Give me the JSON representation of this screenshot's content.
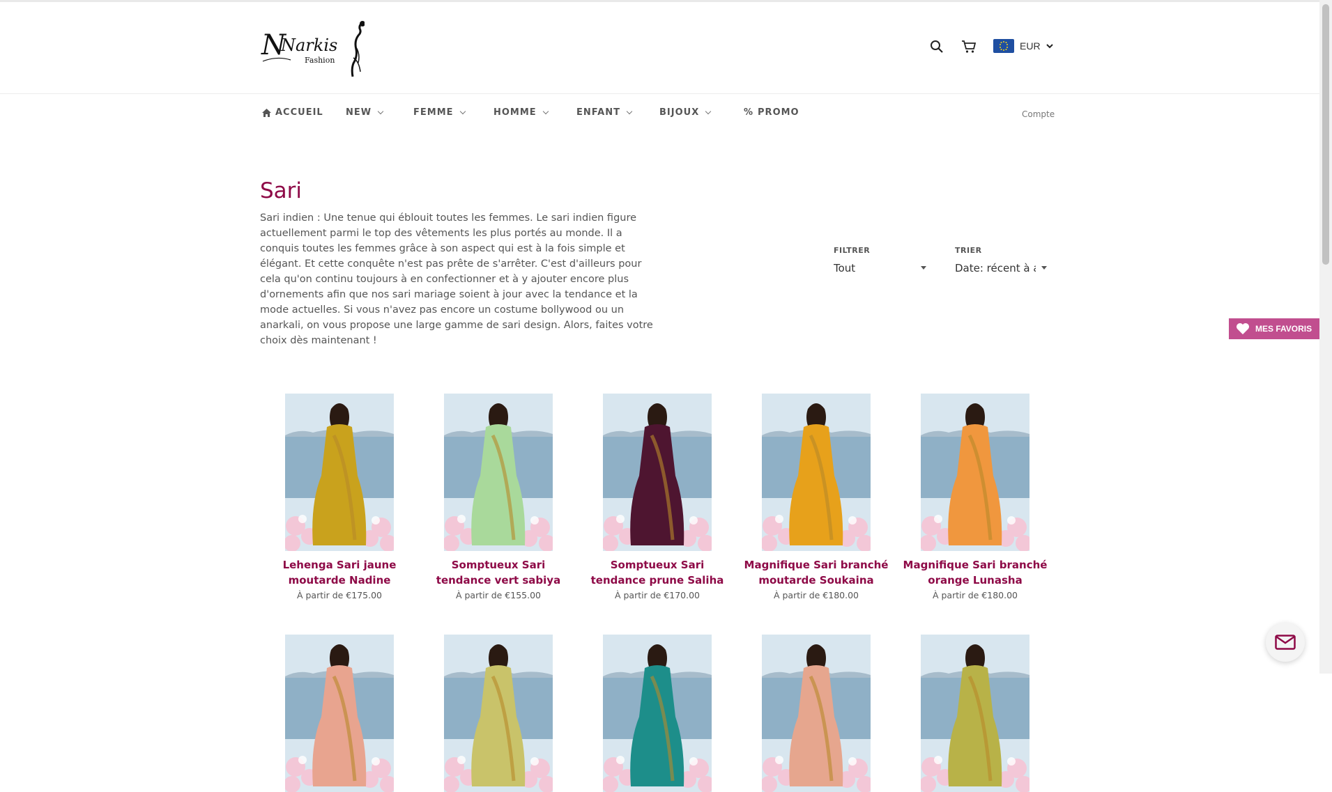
{
  "brand": {
    "name": "Narkis",
    "sub": "Fashion"
  },
  "header": {
    "currency": "EUR"
  },
  "nav": {
    "items": [
      {
        "label": "ACCUEIL",
        "has_home_icon": true
      },
      {
        "label": "NEW",
        "dropdown": true
      },
      {
        "label": "FEMME",
        "dropdown": true
      },
      {
        "label": "HOMME",
        "dropdown": true
      },
      {
        "label": "ENFANT",
        "dropdown": true
      },
      {
        "label": "BIJOUX",
        "dropdown": true
      },
      {
        "label": "PROMO",
        "prefix": "%"
      }
    ],
    "account": "Compte"
  },
  "collection": {
    "title": "Sari",
    "description": "Sari indien : Une tenue qui éblouit toutes les femmes. Le sari indien figure actuellement parmi le top des vêtements les plus portés au monde. Il a conquis toutes les femmes grâce à son aspect qui est à la fois simple et élégant. Et cette conquête n'est pas prête de s'arrêter. C'est d'ailleurs pour cela qu'on continu toujours à en confectionner et à y ajouter encore plus d'ornements afin que nos sari mariage soient à jour avec la tendance et la mode actuelles. Si vous n'avez pas encore un costume bollywood ou un anarkali, on vous propose une large gamme de sari design. Alors, faites votre choix dès maintenant !",
    "filter_label": "FILTRER",
    "filter_value": "Tout",
    "sort_label": "TRIER",
    "sort_value": "Date: récent à a"
  },
  "favorites": {
    "label": "MES FAVORIS"
  },
  "products": [
    {
      "name": "Lehenga Sari jaune moutarde Nadine",
      "price": "À partir de €175.00",
      "color": "#c9a21d"
    },
    {
      "name": "Somptueux Sari tendance vert sabiya",
      "price": "À partir de €155.00",
      "color": "#a9d99b"
    },
    {
      "name": "Somptueux Sari tendance prune Saliha",
      "price": "À partir de €170.00",
      "color": "#4e1530"
    },
    {
      "name": "Magnifique Sari branché moutarde Soukaina",
      "price": "À partir de €180.00",
      "color": "#e7a11b"
    },
    {
      "name": "Magnifique Sari branché orange Lunasha",
      "price": "À partir de €180.00",
      "color": "#f0973e"
    }
  ],
  "products_row2_colors": [
    "#e8a48f",
    "#c9c36a",
    "#1d8e8a",
    "#e6a68e",
    "#b8b248"
  ],
  "colors": {
    "accent": "#8e0a47",
    "favorites": "#c14e8f"
  }
}
